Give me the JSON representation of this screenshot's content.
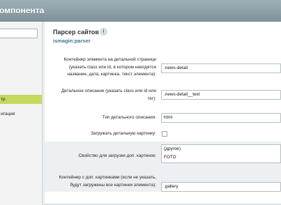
{
  "header": {
    "title": "омпонента"
  },
  "left_panel": {
    "search": {
      "value": ""
    },
    "items": [
      {
        "label": "тр",
        "active": true
      },
      {
        "label": "игация",
        "active": false
      }
    ]
  },
  "main": {
    "title": "Парсер сайтов",
    "info_icon": "i",
    "code": "ismagin:parser",
    "rows": {
      "detail_container": {
        "label": "Контейнер элемента на детальной странице (указать class или id, в котором находятся название, дата, картинка, текст элемента):",
        "value": ".news-detail"
      },
      "detail_text": {
        "label": "Детальное описание (указать class или id или тег):",
        "value": ".news-detail__text"
      },
      "detail_text_type": {
        "label": "Тип детального описания:",
        "value": "html"
      },
      "load_detail_picture": {
        "label": "Загружать детальную картинку:",
        "checked": false
      },
      "extra_pictures_property": {
        "label": "Свойство для загрузки доп. картинок:",
        "options": [
          "(другое)",
          "FOTO"
        ]
      },
      "extra_pictures_container": {
        "label": "Контейнер с доп. картинками (если не указать, будут загружены все картинки элемента):",
        "value": ".gallery"
      }
    }
  }
}
